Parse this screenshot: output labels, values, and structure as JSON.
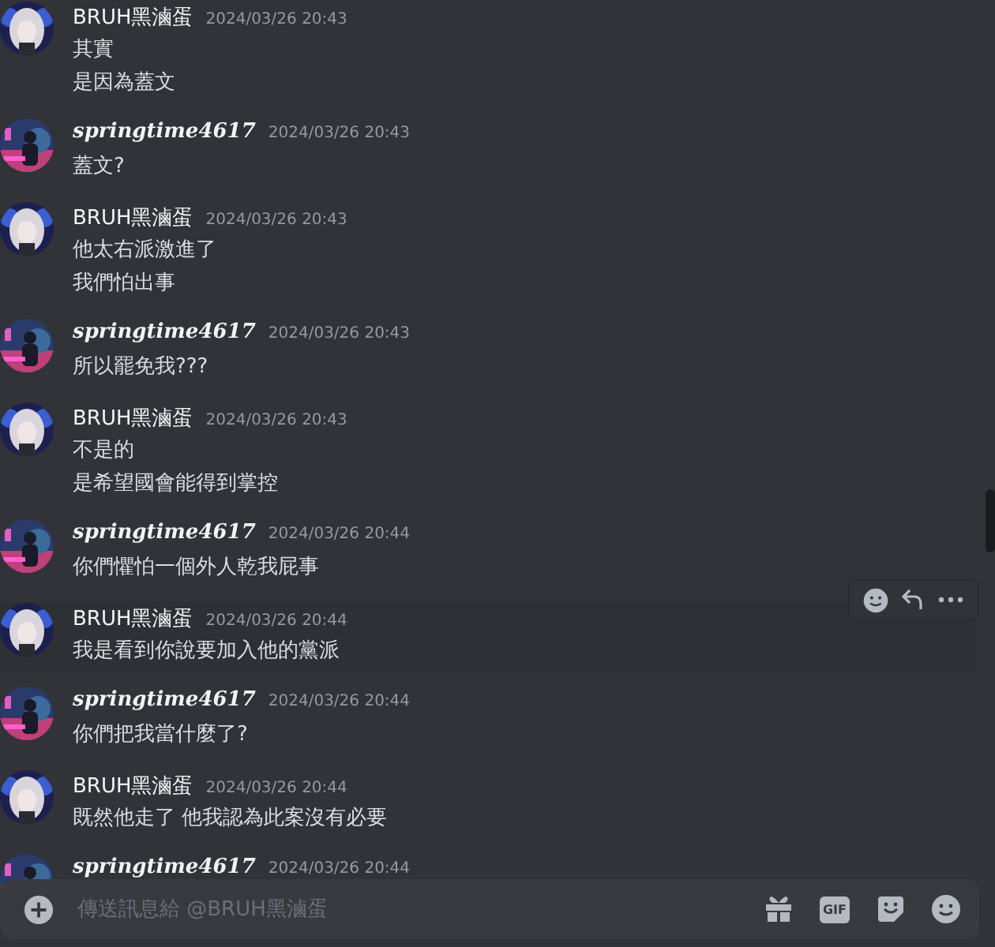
{
  "messages": [
    {
      "kind": "plain",
      "author": "BRUH黑滷蛋",
      "time": "2024/03/26 20:43",
      "hovered": false,
      "lines": [
        "其實",
        "是因為蓋文"
      ]
    },
    {
      "kind": "fancy",
      "author": "springtime4617",
      "time": "2024/03/26 20:43",
      "hovered": false,
      "lines": [
        "蓋文?"
      ]
    },
    {
      "kind": "plain",
      "author": "BRUH黑滷蛋",
      "time": "2024/03/26 20:43",
      "hovered": false,
      "lines": [
        "他太右派激進了",
        "我們怕出事"
      ]
    },
    {
      "kind": "fancy",
      "author": "springtime4617",
      "time": "2024/03/26 20:43",
      "hovered": false,
      "lines": [
        "所以罷免我???"
      ]
    },
    {
      "kind": "plain",
      "author": "BRUH黑滷蛋",
      "time": "2024/03/26 20:43",
      "hovered": false,
      "lines": [
        "不是的",
        "是希望國會能得到掌控"
      ]
    },
    {
      "kind": "fancy",
      "author": "springtime4617",
      "time": "2024/03/26 20:44",
      "hovered": false,
      "lines": [
        "你們懼怕一個外人乾我屁事"
      ]
    },
    {
      "kind": "plain",
      "author": "BRUH黑滷蛋",
      "time": "2024/03/26 20:44",
      "hovered": true,
      "lines": [
        "我是看到你說要加入他的黨派"
      ]
    },
    {
      "kind": "fancy",
      "author": "springtime4617",
      "time": "2024/03/26 20:44",
      "hovered": false,
      "lines": [
        "你們把我當什麼了?"
      ]
    },
    {
      "kind": "plain",
      "author": "BRUH黑滷蛋",
      "time": "2024/03/26 20:44",
      "hovered": false,
      "lines": [
        "既然他走了 他我認為此案沒有必要"
      ]
    },
    {
      "kind": "fancy",
      "author": "springtime4617",
      "time": "2024/03/26 20:44",
      "hovered": false
    }
  ],
  "composer": {
    "placeholder": "傳送訊息給 @BRUH黑滷蛋",
    "gif_label": "GIF"
  }
}
